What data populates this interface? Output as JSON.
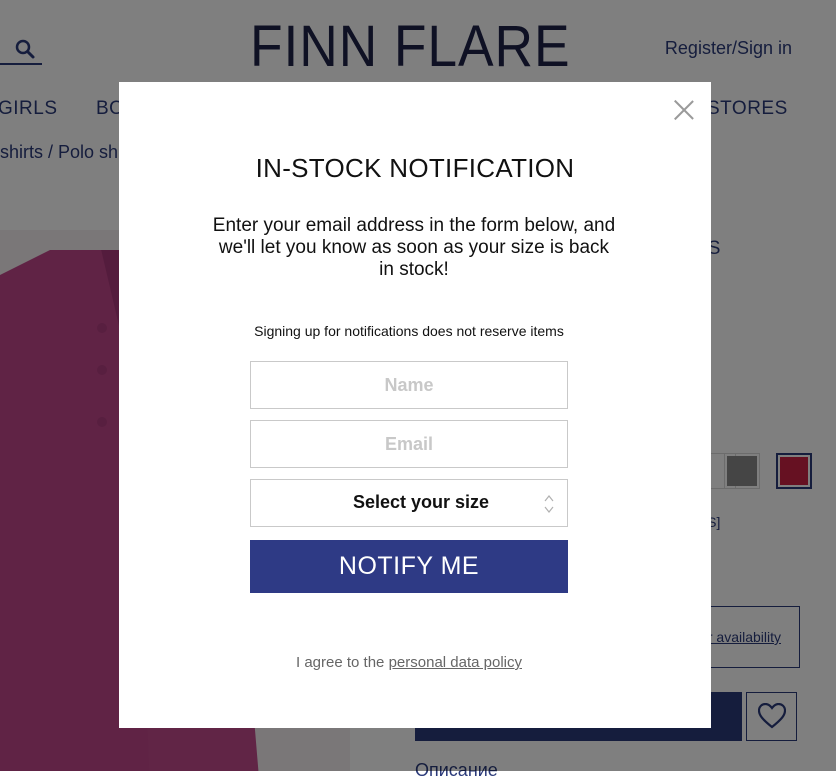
{
  "header": {
    "logo": "FINN FLARE",
    "register_label": "Register/Sign in"
  },
  "nav": {
    "items": [
      {
        "label": "GIRLS"
      },
      {
        "label": "BO"
      },
      {
        "label": "STORES"
      }
    ]
  },
  "breadcrumb": "shirts /  Polo sh",
  "product": {
    "brand_partial": "RS",
    "sizes_partial": "ALS]",
    "availability_label": "r availability",
    "description_partial": "Описание",
    "swatches": [
      {
        "color": "#ffffff"
      },
      {
        "color": "#8a8a8a"
      },
      {
        "color": "#cc2244"
      }
    ]
  },
  "modal": {
    "title": "IN-STOCK NOTIFICATION",
    "text": "Enter your email address in the form below, and we'll let you know as soon as your size is back in stock!",
    "note": "Signing up for notifications does not reserve items",
    "name_placeholder": "Name",
    "email_placeholder": "Email",
    "size_select": "Select your size",
    "notify_label": "NOTIFY ME",
    "agree_prefix": "I agree to the ",
    "agree_link": "personal data policy"
  },
  "colors": {
    "accent": "#2e3a85",
    "brand": "#1e2348"
  }
}
